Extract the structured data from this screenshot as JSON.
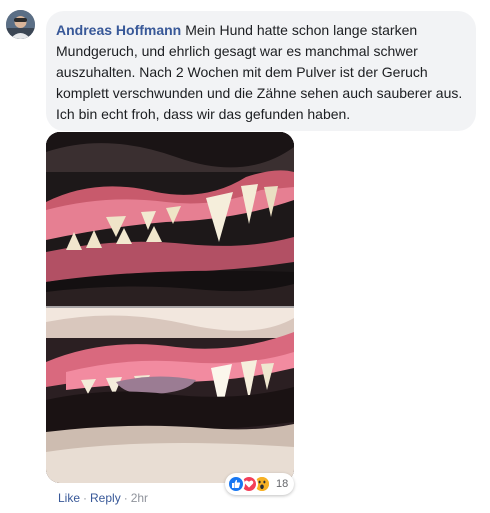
{
  "comment": {
    "author": "Andreas Hoffmann",
    "text": "Mein Hund hatte schon lange starken Mundgeruch, und ehrlich gesagt war es manchmal schwer auszuhalten. Nach 2 Wochen mit dem Pulver ist der Geruch komplett verschwunden und die Zähne sehen auch sauberer aus. Ich bin echt froh, dass wir das gefunden haben."
  },
  "reactions": {
    "icons": [
      "like-icon",
      "love-icon",
      "wow-icon"
    ],
    "count": "18"
  },
  "actions": {
    "like_label": "Like",
    "separator": "·",
    "reply_label": "Reply",
    "time": "2hr"
  },
  "colors": {
    "author": "#385898",
    "bubble": "#f2f3f5",
    "like": "#1877f2",
    "love": "#f33e58",
    "wow": "#f7b125"
  }
}
